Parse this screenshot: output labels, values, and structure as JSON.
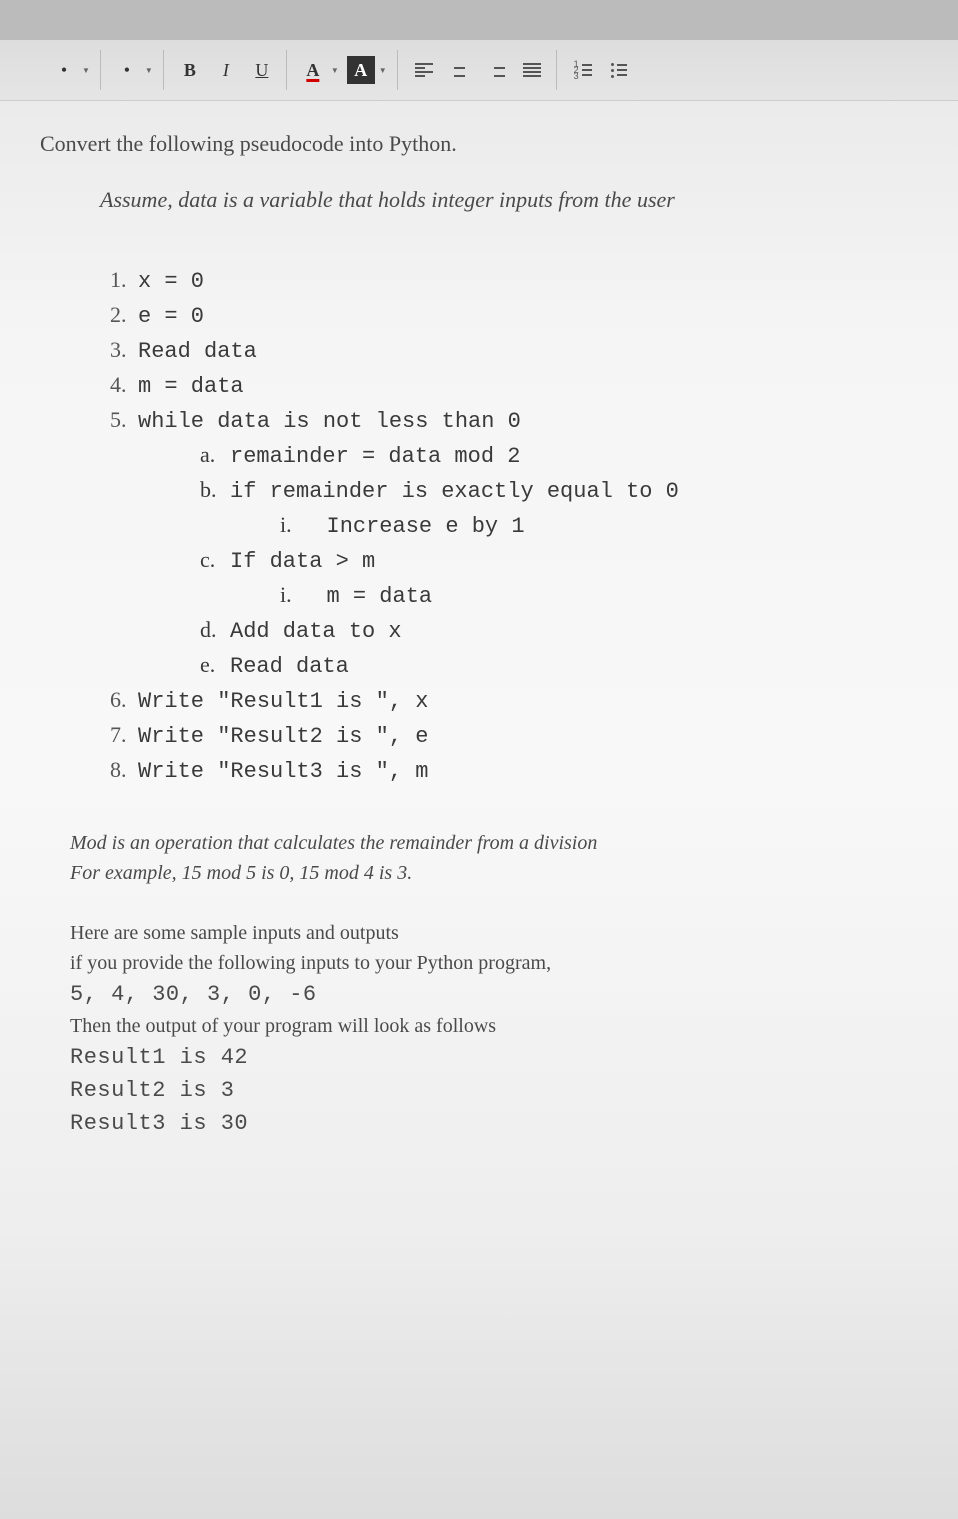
{
  "toolbar": {
    "bold_glyph": "B",
    "italic_glyph": "I",
    "underline_glyph": "U",
    "font_color_glyph": "A",
    "highlight_glyph": "A"
  },
  "doc": {
    "title": "Convert the following pseudocode into Python.",
    "assume": "Assume, data is a variable that holds integer inputs from the user"
  },
  "pseudo": {
    "l1": {
      "n": "1.",
      "t": "x = 0"
    },
    "l2": {
      "n": "2.",
      "t": "e = 0"
    },
    "l3": {
      "n": "3.",
      "t": "Read data"
    },
    "l4": {
      "n": "4.",
      "t": "m = data"
    },
    "l5": {
      "n": "5.",
      "t": "while data is not less than 0"
    },
    "l5a": {
      "n": "a.",
      "t": "remainder = data mod 2"
    },
    "l5b": {
      "n": "b.",
      "t": "if remainder is exactly equal to 0"
    },
    "l5bi": {
      "n": "i.",
      "t": "Increase e by 1"
    },
    "l5c": {
      "n": "c.",
      "t": "If data > m"
    },
    "l5ci": {
      "n": "i.",
      "t": "m = data"
    },
    "l5d": {
      "n": "d.",
      "t": "Add data to x"
    },
    "l5e": {
      "n": "e.",
      "t": "Read data"
    },
    "l6": {
      "n": "6.",
      "t": "Write \"Result1 is \", x"
    },
    "l7": {
      "n": "7.",
      "t": "Write \"Result2 is \", e"
    },
    "l8": {
      "n": "8.",
      "t": "Write \"Result3 is \", m"
    }
  },
  "notes": {
    "mod1": "Mod is an operation that calculates the remainder from a division",
    "mod2": "For example, 15 mod 5 is 0, 15 mod 4 is 3.",
    "sample_h": "Here are some sample inputs and outputs",
    "sample_if": "if you provide the following inputs to your Python program,",
    "inputs": "5, 4, 30, 3, 0, -6",
    "then": "Then the output of your program will look as follows",
    "r1": "Result1 is 42",
    "r2": "Result2 is 3",
    "r3": "Result3 is 30"
  }
}
